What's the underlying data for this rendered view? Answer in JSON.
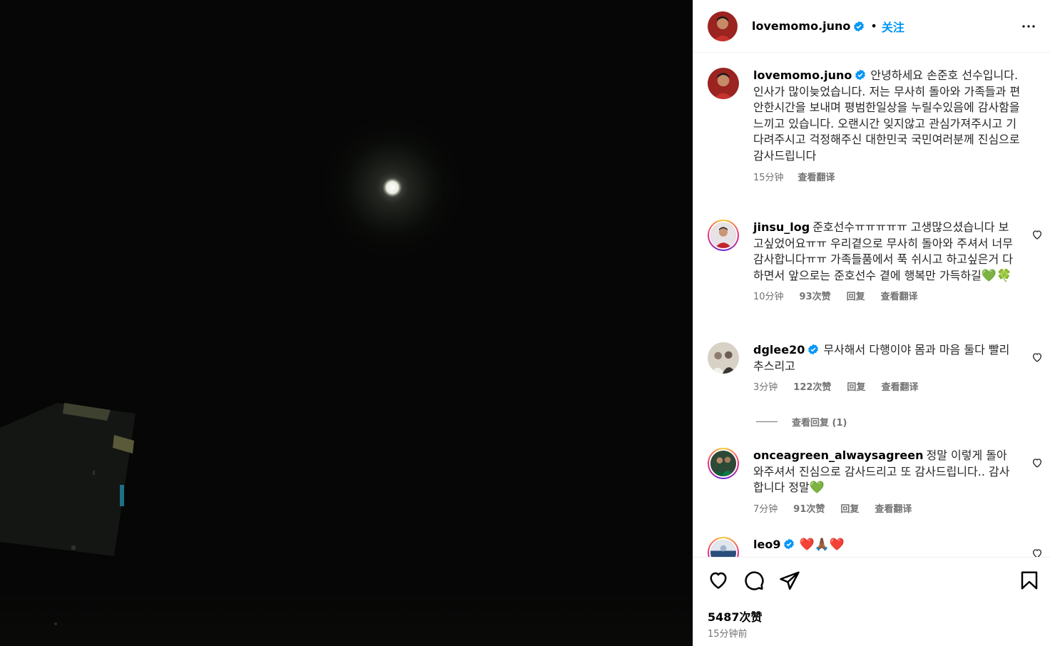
{
  "post": {
    "username": "lovemomo.juno",
    "follow_label": "关注",
    "dot": "•",
    "caption": "안녕하세요 손준호 선수입니다. 인사가 많이늦었습니다. 저는 무사히 돌아와 가족들과 편안한시간을 보내며 평범한일상을 누릴수있음에 감사함을 느끼고 있습니다. 오랜시간 잊지않고 관심가져주시고 기다려주시고 걱정해주신 대한민국 국민여러분께 진심으로 감사드립니다",
    "caption_time": "15分钟",
    "see_translation": "查看翻译",
    "likes": "5487次赞",
    "posted_time": "15分钟前"
  },
  "comments": [
    {
      "username": "jinsu_log",
      "text": "준호선수ㅠㅠㅠㅠㅠ 고생많으셨습니다 보고싶었어요ㅠㅠ 우리곁으로 무사히 돌아와 주셔서 너무 감사합니다ㅠㅠ 가족들품에서 푹 쉬시고 하고싶은거 다하면서 앞으로는 준호선수 곁에 행복만 가득하길",
      "emoji": "💚🍀",
      "time": "10分钟",
      "likes": "93次赞",
      "reply": "回复",
      "translate": "查看翻译"
    },
    {
      "username": "dglee20",
      "text": "무사해서 다행이야 몸과 마음 둘다 빨리 추스리고",
      "emoji": "",
      "time": "3分钟",
      "likes": "122次赞",
      "reply": "回复",
      "translate": "查看翻译"
    },
    {
      "username": "onceagreen_alwaysagreen",
      "text": "정말 이렇게 돌아와주셔서 진심으로 감사드리고 또 감사드립니다.. 감사합니다 정말",
      "emoji": "💚",
      "time": "7分钟",
      "likes": "91次赞",
      "reply": "回复",
      "translate": "查看翻译"
    },
    {
      "username": "leo9",
      "text": "",
      "emoji": "❤️🙏🏾❤️",
      "time": "",
      "likes": "",
      "reply": "",
      "translate": ""
    }
  ],
  "view_replies": "查看回复 (1)",
  "colors": {
    "accent": "#0095f6",
    "muted": "#737373",
    "verified": "#0095f6"
  },
  "icons": [
    "more-icon",
    "heart-icon",
    "comment-icon",
    "share-icon",
    "save-icon",
    "verified-icon"
  ]
}
